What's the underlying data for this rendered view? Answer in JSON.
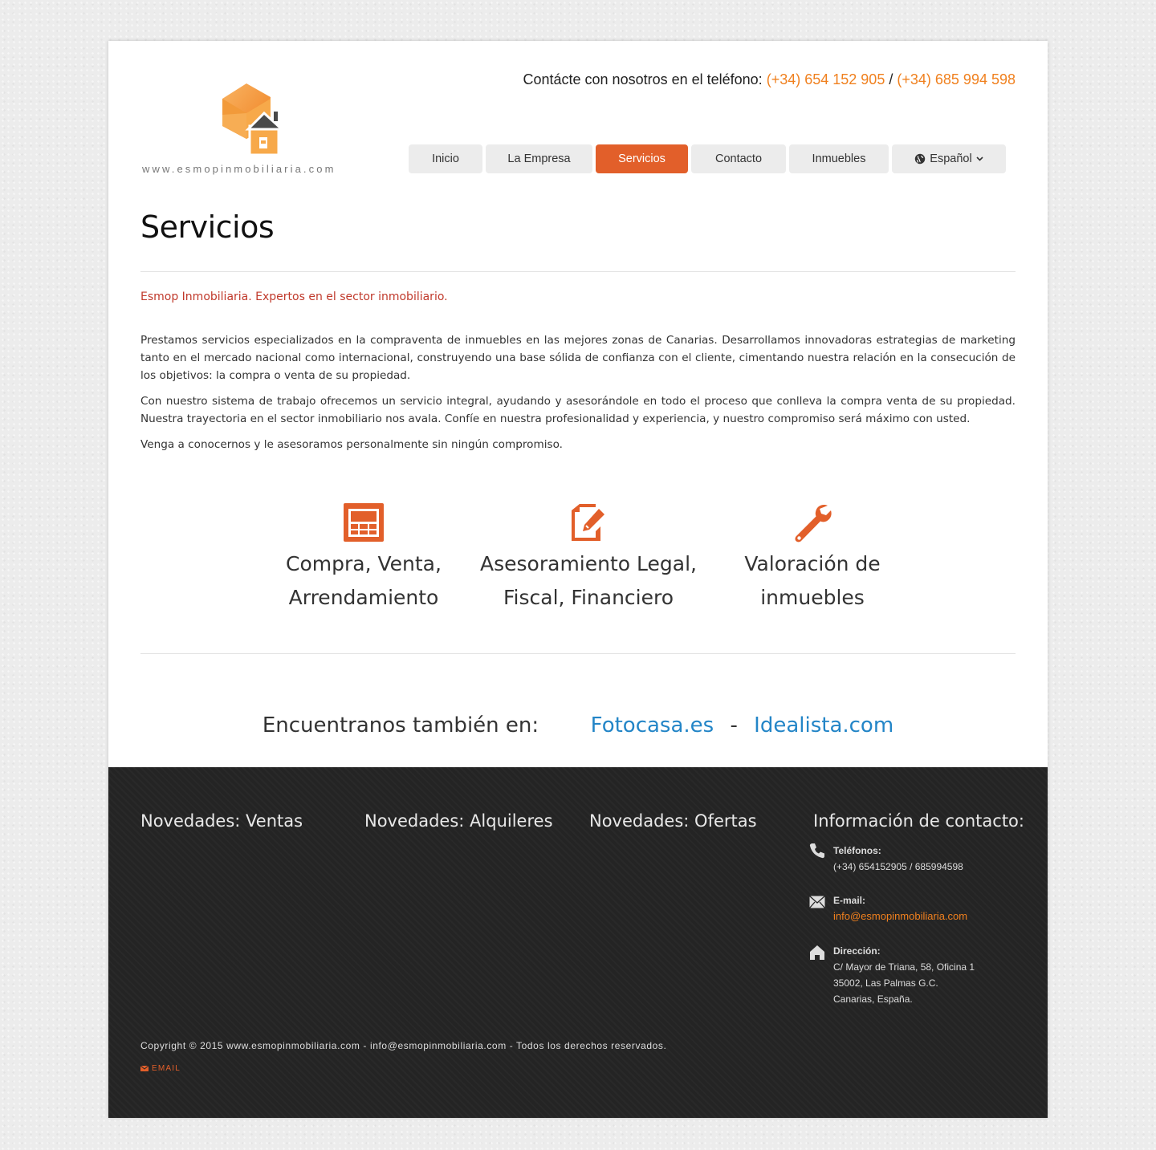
{
  "header": {
    "logo_url_text": "www.esmopinmobiliaria.com",
    "contact_prefix": "Contácte con nosotros en el teléfono:",
    "phone1": "(+34) 654 152 905",
    "phone_sep": "/",
    "phone2": "(+34) 685 994 598"
  },
  "nav": {
    "items": [
      "Inicio",
      "La Empresa",
      "Servicios",
      "Contacto",
      "Inmuebles"
    ],
    "language": "Español",
    "active": "Servicios"
  },
  "main": {
    "title": "Servicios",
    "tagline": "Esmop Inmobiliaria. Expertos en el sector inmobiliario.",
    "paragraphs": [
      "Prestamos servicios especializados en la compraventa de inmuebles en las mejores zonas de Canarias. Desarrollamos innovadoras estrategias de marketing tanto en el mercado nacional como internacional, construyendo una base sólida de confianza con el cliente, cimentando nuestra relación en la consecución de los objetivos: la compra o venta de su propiedad.",
      "Con nuestro sistema de trabajo ofrecemos un servicio integral, ayudando y asesorándole en todo el proceso que conlleva la compra venta de su propiedad. Nuestra trayectoria en el sector inmobiliario nos avala. Confíe en nuestra profesionalidad y experiencia, y nuestro compromiso será máximo con usted.",
      "Venga a conocernos y le asesoramos personalmente sin ningún compromiso."
    ],
    "services": [
      {
        "icon": "window-icon",
        "line1": "Compra, Venta,",
        "line2": "Arrendamiento"
      },
      {
        "icon": "edit-document-icon",
        "line1": "Asesoramiento Legal,",
        "line2": "Fiscal, Financiero"
      },
      {
        "icon": "wrench-icon",
        "line1": "Valoración de",
        "line2": "inmuebles"
      }
    ],
    "find_label": "Encuentranos también en:",
    "find_link1": "Fotocasa.es",
    "find_sep": "-",
    "find_link2": "Idealista.com"
  },
  "footer": {
    "col1_title": "Novedades: Ventas",
    "col2_title": "Novedades: Alquileres",
    "col3_title": "Novedades: Ofertas",
    "col4_title": "Información de contacto:",
    "phones_label": "Teléfonos:",
    "phones_value": "(+34) 654152905 / 685994598",
    "email_label": "E-mail:",
    "email_value": "info@esmopinmobiliaria.com",
    "address_label": "Dirección:",
    "address_line1": "C/ Mayor de Triana, 58, Oficina 1",
    "address_line2": "35002, Las Palmas G.C.",
    "address_line3": "Canarias, España.",
    "copyright": "Copyright © 2015 www.esmopinmobiliaria.com - info@esmopinmobiliaria.com - Todos los derechos reservados.",
    "email_link": "EMAIL"
  },
  "colors": {
    "accent": "#e25f2a",
    "phone_orange": "#f0801e",
    "link_blue": "#2385c7",
    "tagline_red": "#c0392b",
    "footer_bg": "#242424"
  }
}
